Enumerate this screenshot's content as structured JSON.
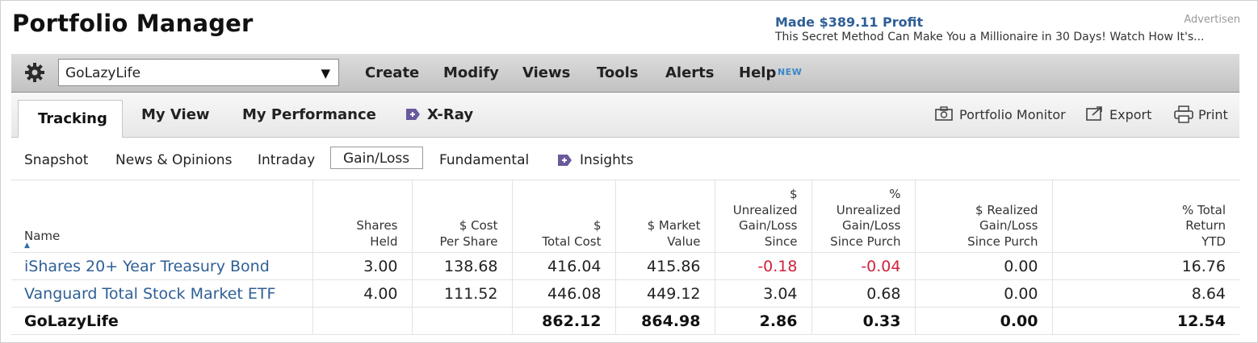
{
  "header": {
    "title": "Portfolio Manager",
    "ad_label": "Advertisen",
    "ad_headline": "Made $389.11 Profit",
    "ad_body": "This Secret Method Can Make You a Millionaire in 30 Days! Watch How It's..."
  },
  "toolbar": {
    "portfolio_select": "GoLazyLife",
    "menu": [
      "Create",
      "Modify",
      "Views",
      "Tools",
      "Alerts",
      "Help"
    ],
    "help_badge": "NEW"
  },
  "tabs": {
    "active": "Tracking",
    "items": [
      "My View",
      "My Performance",
      "X-Ray"
    ],
    "actions": [
      "Portfolio Monitor",
      "Export",
      "Print"
    ]
  },
  "subtabs": {
    "items": [
      "Snapshot",
      "News & Opinions",
      "Intraday",
      "Gain/Loss",
      "Fundamental",
      "Insights"
    ],
    "active": "Gain/Loss"
  },
  "table": {
    "columns": [
      [
        "Name"
      ],
      [
        "Shares",
        "Held"
      ],
      [
        "$ Cost",
        "Per Share"
      ],
      [
        "$",
        "Total Cost"
      ],
      [
        "$ Market",
        "Value"
      ],
      [
        "$",
        "Unrealized",
        "Gain/Loss",
        "Since"
      ],
      [
        "%",
        "Unrealized",
        "Gain/Loss",
        "Since Purch"
      ],
      [
        "$ Realized",
        "Gain/Loss",
        "Since Purch"
      ],
      [
        "% Total",
        "Return",
        "YTD"
      ]
    ],
    "rows": [
      [
        "iShares 20+ Year Treasury Bond",
        "3.00",
        "138.68",
        "416.04",
        "415.86",
        "-0.18",
        "-0.04",
        "0.00",
        "16.76"
      ],
      [
        "Vanguard Total Stock Market ETF",
        "4.00",
        "111.52",
        "446.08",
        "449.12",
        "3.04",
        "0.68",
        "0.00",
        "8.64"
      ]
    ],
    "total": [
      "GoLazyLife",
      "",
      "",
      "862.12",
      "864.98",
      "2.86",
      "0.33",
      "0.00",
      "12.54"
    ]
  },
  "colors": {
    "link": "#2f5f96",
    "negative": "#d0213c",
    "badge": "#3a86c8",
    "menubar": "#c9c9c9"
  }
}
